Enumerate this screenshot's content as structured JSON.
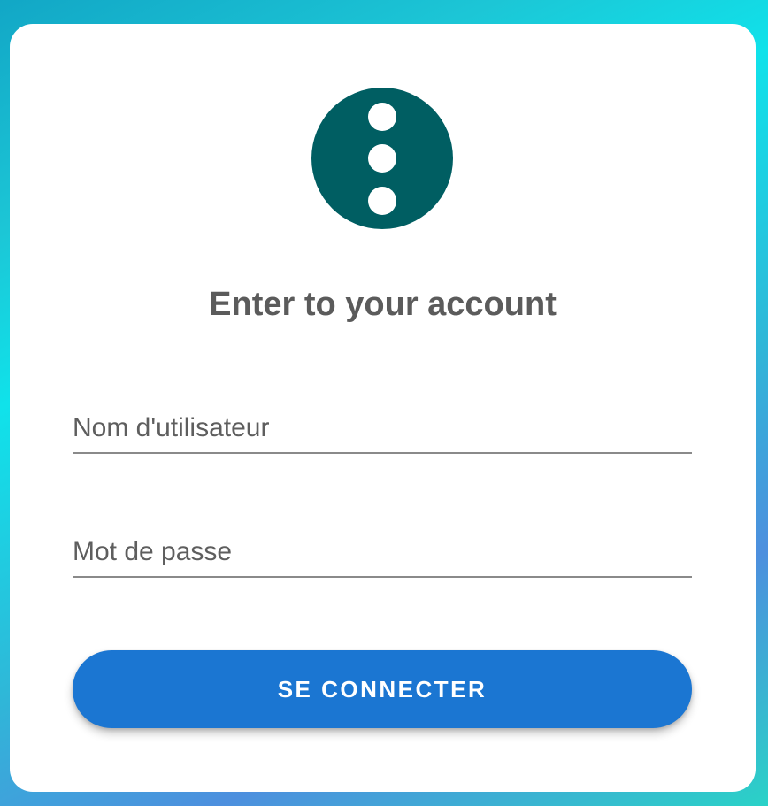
{
  "colors": {
    "logo_background": "#005e62",
    "button_background": "#1b76d2",
    "title_text": "#5b5b5b"
  },
  "logo": {
    "icon": "vertical-dots-icon"
  },
  "login": {
    "title": "Enter to your account",
    "username_placeholder": "Nom d'utilisateur",
    "username_value": "",
    "password_placeholder": "Mot de passe",
    "password_value": "",
    "submit_label": "SE CONNECTER"
  }
}
